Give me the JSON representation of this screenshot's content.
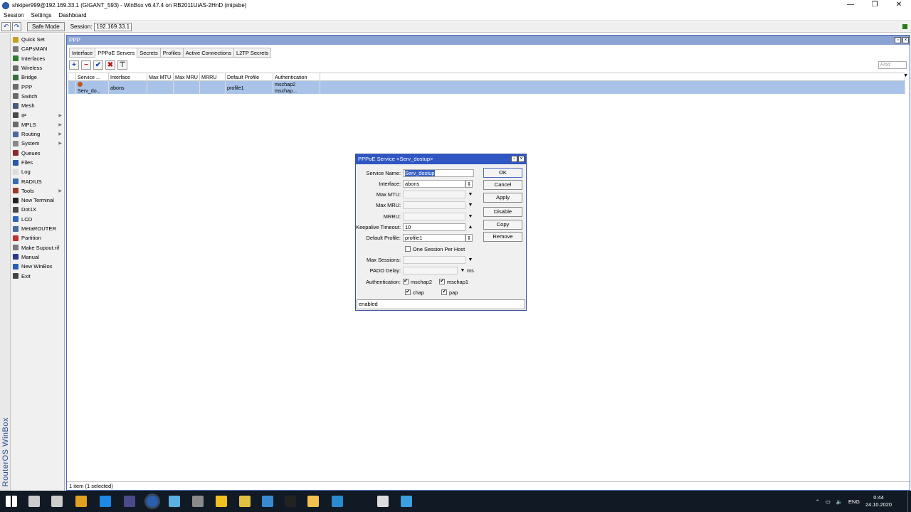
{
  "window": {
    "title": "shkiper999@192.169.33.1 (GIGANT_593) - WinBox v6.47.4 on RB2011UiAS-2HnD (mipsbe)",
    "controls": [
      "—",
      "❐",
      "✕"
    ]
  },
  "menu": [
    "Session",
    "Settings",
    "Dashboard"
  ],
  "toolbar": {
    "undo": "↶",
    "redo": "↷",
    "safe_mode": "Safe Mode",
    "session_label": "Session:",
    "session_value": "192.169.33.1"
  },
  "sidebar": {
    "brand": "RouterOS WinBox",
    "items": [
      {
        "label": "Quick Set",
        "color": "#c7a020",
        "sub": false
      },
      {
        "label": "CAPsMAN",
        "color": "#7a7a7a",
        "sub": false
      },
      {
        "label": "Interfaces",
        "color": "#2f7a2f",
        "sub": false
      },
      {
        "label": "Wireless",
        "color": "#6a6a6a",
        "sub": false
      },
      {
        "label": "Bridge",
        "color": "#3a6b3a",
        "sub": false
      },
      {
        "label": "PPP",
        "color": "#6a6a6a",
        "sub": false
      },
      {
        "label": "Switch",
        "color": "#6a6a6a",
        "sub": false
      },
      {
        "label": "Mesh",
        "color": "#4a5a7a",
        "sub": false
      },
      {
        "label": "IP",
        "color": "#4a4a4a",
        "sub": true
      },
      {
        "label": "MPLS",
        "color": "#6a6a6a",
        "sub": true
      },
      {
        "label": "Routing",
        "color": "#4a6a9a",
        "sub": true
      },
      {
        "label": "System",
        "color": "#888888",
        "sub": true
      },
      {
        "label": "Queues",
        "color": "#8a2a2a",
        "sub": false
      },
      {
        "label": "Files",
        "color": "#2a5aa0",
        "sub": false
      },
      {
        "label": "Log",
        "color": "#dddddd",
        "sub": false
      },
      {
        "label": "RADIUS",
        "color": "#3a6ab0",
        "sub": false
      },
      {
        "label": "Tools",
        "color": "#9a3a2a",
        "sub": true
      },
      {
        "label": "New Terminal",
        "color": "#222222",
        "sub": false
      },
      {
        "label": "Dot1X",
        "color": "#4a4a4a",
        "sub": false
      },
      {
        "label": "LCD",
        "color": "#2a6ab0",
        "sub": false
      },
      {
        "label": "MetaROUTER",
        "color": "#4a6a9a",
        "sub": false
      },
      {
        "label": "Partition",
        "color": "#c03030",
        "sub": false
      },
      {
        "label": "Make Supout.rif",
        "color": "#7a7a7a",
        "sub": false
      },
      {
        "label": "Manual",
        "color": "#2a3a8a",
        "sub": false
      },
      {
        "label": "New WinBox",
        "color": "#2a5fb0",
        "sub": false
      },
      {
        "label": "Exit",
        "color": "#444444",
        "sub": false
      }
    ]
  },
  "ppp_window": {
    "title": "PPP",
    "tabs": [
      "Interface",
      "PPPoE Servers",
      "Secrets",
      "Profiles",
      "Active Connections",
      "L2TP Secrets"
    ],
    "active_tab": "PPPoE Servers",
    "actions": {
      "add": "+",
      "remove": "−",
      "enable": "✔",
      "disable": "✖",
      "filter": "⊤"
    },
    "find_placeholder": "Find",
    "columns": [
      "Service ...",
      "Interface",
      "Max MTU",
      "Max MRU",
      "MRRU",
      "Default Profile",
      "Authentication"
    ],
    "rows": [
      [
        "Serv_do...",
        "abons",
        "",
        "",
        "",
        "profile1",
        "mschap2 mschap..."
      ]
    ],
    "status": "1 item (1 selected)"
  },
  "dialog": {
    "title": "PPPoE Service <Serv_dostup>",
    "fields": {
      "service_name_label": "Service Name:",
      "service_name_value": "Serv_dostup",
      "interface_label": "Interface:",
      "interface_value": "abons",
      "max_mtu_label": "Max MTU:",
      "max_mru_label": "Max MRU:",
      "mrru_label": "MRRU:",
      "keepalive_label": "Keepalive Timeout:",
      "keepalive_value": "10",
      "default_profile_label": "Default Profile:",
      "default_profile_value": "profile1",
      "one_session_label": "One Session Per Host",
      "max_sessions_label": "Max Sessions:",
      "pado_delay_label": "PADO Delay:",
      "pado_unit": "ms",
      "authentication_label": "Authentication:",
      "auth_mschap2": "mschap2",
      "auth_mschap1": "mschap1",
      "auth_chap": "chap",
      "auth_pap": "pap"
    },
    "checks": {
      "one_session": false,
      "mschap2": true,
      "mschap1": true,
      "chap": true,
      "pap": true
    },
    "buttons": {
      "ok": "OK",
      "cancel": "Cancel",
      "apply": "Apply",
      "disable": "Disable",
      "copy": "Copy",
      "remove": "Remove"
    },
    "status": "enabled"
  },
  "taskbar": {
    "tray_lang": "ENG",
    "time": "0:44",
    "date": "24.10.2020",
    "apps": [
      {
        "name": "start",
        "color": "#ffffff"
      },
      {
        "name": "search",
        "color": "#cccccc"
      },
      {
        "name": "task-view",
        "color": "#cccccc"
      },
      {
        "name": "chrome",
        "color": "#e0a020"
      },
      {
        "name": "app-2",
        "color": "#1e88e5"
      },
      {
        "name": "app-3",
        "color": "#4a4a8a"
      },
      {
        "name": "winbox",
        "color": "#2a5fb0"
      },
      {
        "name": "app-5",
        "color": "#5ab0e0"
      },
      {
        "name": "app-6",
        "color": "#8a8a8a"
      },
      {
        "name": "app-7",
        "color": "#f0c020"
      },
      {
        "name": "app-8",
        "color": "#e0c040"
      },
      {
        "name": "app-9",
        "color": "#3a8ad0"
      },
      {
        "name": "app-10",
        "color": "#222222"
      },
      {
        "name": "explorer",
        "color": "#f2c14e"
      },
      {
        "name": "app-12",
        "color": "#2a8ad0"
      },
      {
        "name": "settings",
        "color": "#dddddd"
      },
      {
        "name": "app-14",
        "color": "#3aa0e0"
      }
    ]
  }
}
